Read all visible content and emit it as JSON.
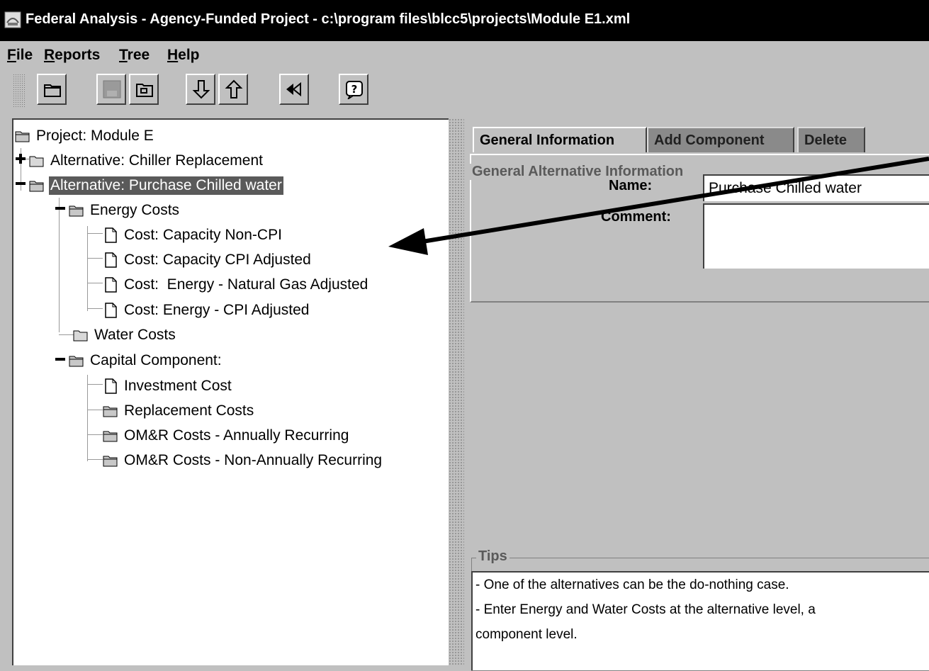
{
  "window": {
    "title": "Federal Analysis - Agency-Funded Project - c:\\program files\\blcc5\\projects\\Module E1.xml"
  },
  "menu": [
    "File",
    "Reports",
    "Tree",
    "Help"
  ],
  "toolbar": {
    "buttons": [
      "open-folder-icon",
      "save-icon",
      "open-project-icon",
      "move-down-icon",
      "move-up-icon",
      "back-icon",
      "help-icon"
    ]
  },
  "tree": {
    "nodes": [
      {
        "label": "Project: Module E",
        "icon": "open-folder-icon"
      },
      {
        "label": "Alternative: Chiller Replacement",
        "icon": "folder-icon",
        "handle": "expand"
      },
      {
        "label": "Alternative: Purchase Chilled water",
        "icon": "open-folder-icon",
        "handle": "collapse",
        "selected": true
      },
      {
        "label": "Energy Costs",
        "icon": "open-folder-icon",
        "handle": "collapse"
      },
      {
        "label": "Cost: Capacity Non-CPI",
        "icon": "document-icon"
      },
      {
        "label": "Cost: Capacity CPI Adjusted",
        "icon": "document-icon"
      },
      {
        "label": "Cost:  Energy - Natural Gas Adjusted",
        "icon": "document-icon"
      },
      {
        "label": "Cost: Energy - CPI Adjusted",
        "icon": "document-icon"
      },
      {
        "label": "Water Costs",
        "icon": "folder-icon"
      },
      {
        "label": "Capital Component:",
        "icon": "open-folder-icon",
        "handle": "collapse"
      },
      {
        "label": "Investment Cost",
        "icon": "document-icon"
      },
      {
        "label": "Replacement Costs",
        "icon": "open-folder-icon"
      },
      {
        "label": "OM&R Costs - Annually Recurring",
        "icon": "open-folder-icon"
      },
      {
        "label": "OM&R Costs - Non-Annually Recurring",
        "icon": "open-folder-icon"
      }
    ]
  },
  "tabs": [
    {
      "label": "General Information",
      "active": true
    },
    {
      "label": "Add Component",
      "active": false
    },
    {
      "label": "Delete",
      "active": false
    }
  ],
  "general": {
    "legend": "General Alternative Information",
    "name_label": "Name:",
    "name_value": "Purchase Chilled water",
    "comment_label": "Comment:",
    "comment_value": ""
  },
  "tips": {
    "legend": "Tips",
    "lines": [
      "- One of the alternatives can be the do-nothing case.",
      "- Enter Energy and Water Costs at the alternative level, a",
      "component level."
    ]
  },
  "colors": {
    "titlebar": "#000000",
    "chrome": "#c0c0c0",
    "selection": "#5a5a5a"
  }
}
